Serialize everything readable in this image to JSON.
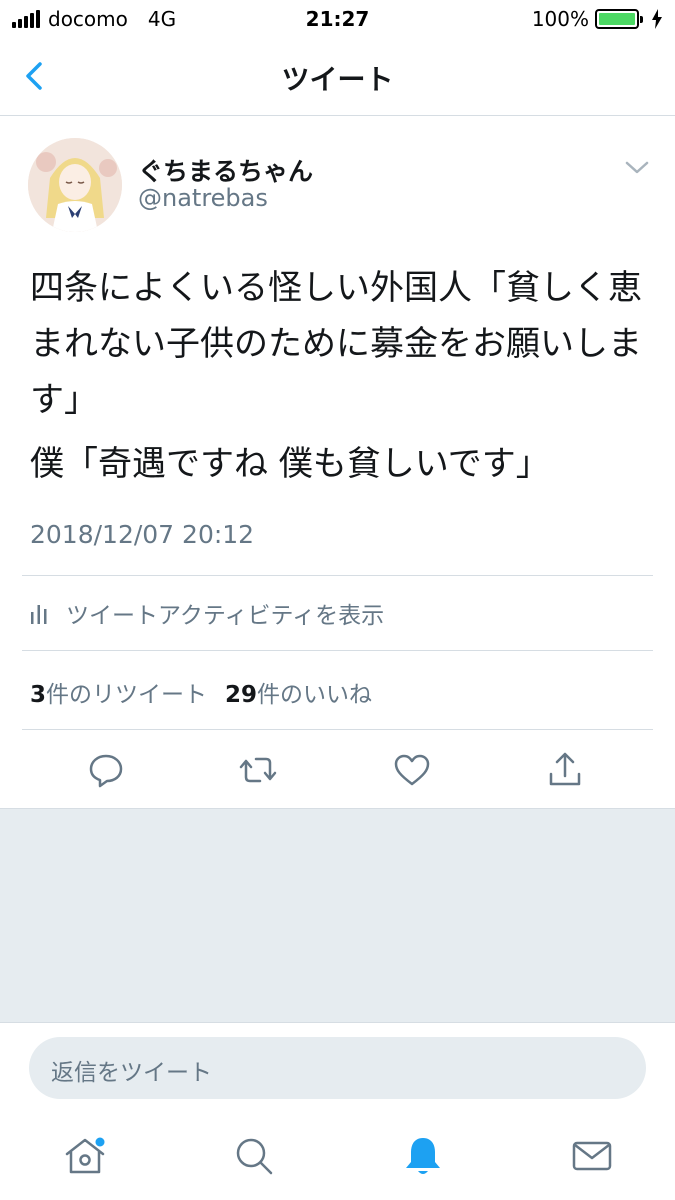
{
  "status_bar": {
    "carrier": "docomo",
    "network": "4G",
    "time": "21:27",
    "battery": "100%",
    "battery_color": "#4cd964"
  },
  "nav": {
    "title": "ツイート",
    "back_icon": "chevron-left-icon",
    "accent": "#1da1f2"
  },
  "tweet": {
    "display_name": "ぐちまるちゃん",
    "handle": "@natrebas",
    "text_line1": "四条によくいる怪しい外国人「貧しく恵まれない子供のために募金をお願いします」",
    "text_line2": "僕「奇遇ですね 僕も貧しいです」",
    "timestamp": "2018/12/07 20:12",
    "activity_label": "ツイートアクティビティを表示",
    "retweet_count": "3",
    "retweet_label": "件のリツイート",
    "like_count": "29",
    "like_label": "件のいいね"
  },
  "actions": [
    "reply-icon",
    "retweet-icon",
    "like-icon",
    "share-icon"
  ],
  "reply": {
    "placeholder": "返信をツイート"
  },
  "tab_bar": [
    "home-icon",
    "search-icon",
    "notifications-icon",
    "messages-icon"
  ]
}
